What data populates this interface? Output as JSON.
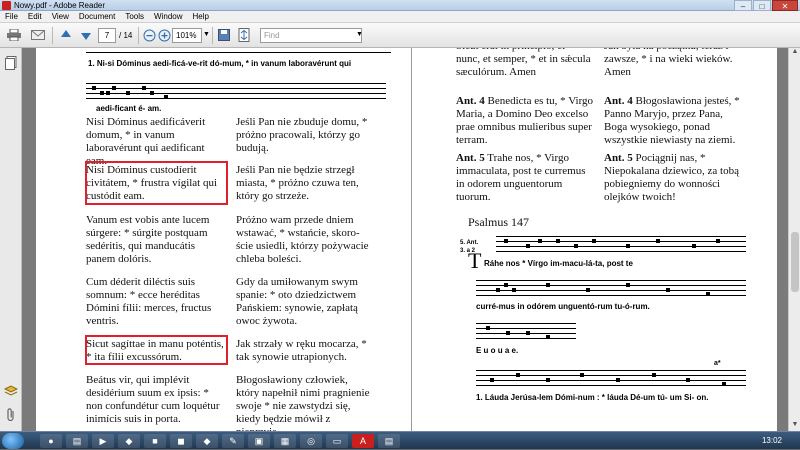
{
  "window": {
    "title": "Nowy.pdf - Adobe Reader",
    "minimize": "–",
    "maximize": "□",
    "close": "✕"
  },
  "menu": [
    "File",
    "Edit",
    "View",
    "Document",
    "Tools",
    "Window",
    "Help"
  ],
  "toolbar": {
    "page_current": "7",
    "page_total": "/ 14",
    "zoom": "101%",
    "find_placeholder": "Find"
  },
  "icons": {
    "print": "printer-icon",
    "email": "email-icon",
    "prev": "arrow-up-icon",
    "next": "arrow-down-icon",
    "zoom_out": "zoom-out-icon",
    "zoom_in": "zoom-in-icon",
    "save": "save-icon",
    "fit": "fit-page-icon",
    "attach": "paperclip-icon",
    "layers": "layers-icon",
    "pages": "pages-icon"
  },
  "left_column": {
    "music_top_lyrics": "1. Ni-si Dóminus aedi-ficá-ve-rit dó-mum, * in vanum laboravérunt qui",
    "music_top_lyrics2": "aedi-ficant é-  am.",
    "p1_latin": "Nisi Dóminus aedificáverit domum, * in vanum laboravérunt qui aedificant eam.",
    "p1_polish": "Jeśli Pan nie zbuduje domu, * próżno pracowali, którzy go budują.",
    "p2_latin": "Nisi Dóminus custodíerit civitátem, * frustra vígilat qui custódit eam.",
    "p2_polish": "Jeśli Pan nie będzie strzegł miasta, * próżno czuwa ten, który go strzeże.",
    "p3_latin": "Vanum est vobis ante lucem súrgere: * súrgite postquam sedéritis, qui manducátis panem dolóris.",
    "p3_polish": "Próżno wam przede dniem wstawać, * wstańcie, skoro-ście usiedli, którzy pożywacie chleba boleści.",
    "p4_latin": "Cum déderit diléctis suis somnum: * ecce heréditas Dómini fílii: merces, fructus ventris.",
    "p4_polish": "Gdy da umiłowanym swym spanie: * oto dziedzictwem Pańskiem: synowie, zapłatą owoc żywota.",
    "p5_latin": "Sicut sagíttae in manu poténtis, * ita fílii excussórum.",
    "p5_polish": "Jak strzały w ręku mocarza, * tak synowie utrapionych.",
    "p6_latin": "Beátus vir, qui implévit desidérium suum ex ipsis: * non confundétur cum loquétur inimícis suis in porta.",
    "p6_polish": "Błogosławiony człowiek, który napełnił nimi pragnienie swoje * nie zawstydzi się, kiedy będzie mówił z nieprzyja-"
  },
  "right_column": {
    "top_latin": "Sicut erat in princípio, et nunc, et semper, * et in sǽcula sæculórum. Amen",
    "top_polish": "Jak była na początku, teraz i zawsze, * i na wieki wieków. Amen",
    "ant4_label": "Ant. 4",
    "ant4_latin": "Benedicta es tu, * Virgo Maria, a Domino Deo excelso prae omnibus mulieribus super terram.",
    "ant4_polish": "Błogosławiona jesteś, * Panno Maryjo, przez Pana, Boga wysokiego, ponad wszystkie niewiasty na ziemi.",
    "ant5_label": "Ant. 5",
    "ant5_latin": "Trahe nos, * Virgo immaculata, post te curremus in odorem unguentorum tuorum.",
    "ant5_polish": "Pociągnij nas, * Niepokalana dziewico, za tobą pobiegniemy do wonności olejków twoich!",
    "psalm_title": "Psalmus 147",
    "music_mode": "5. Ant.",
    "music_mode2": "3. a 2",
    "music_lyrics1": "Ráhe nos  * Vírgo  im-macu-lá-ta,   post te",
    "music_lyrics2": "curré-mus   in odórem unguentó-rum tu-ó-rum.",
    "music_lyrics3": "E u o u a e.",
    "music_lyrics4": "1. Láuda Jerúsa-lem Dómi-num : * láuda Dé-um  tú-  um  Si-   on.",
    "music_accent": "a*"
  },
  "taskbar": {
    "clock": "13:02"
  }
}
